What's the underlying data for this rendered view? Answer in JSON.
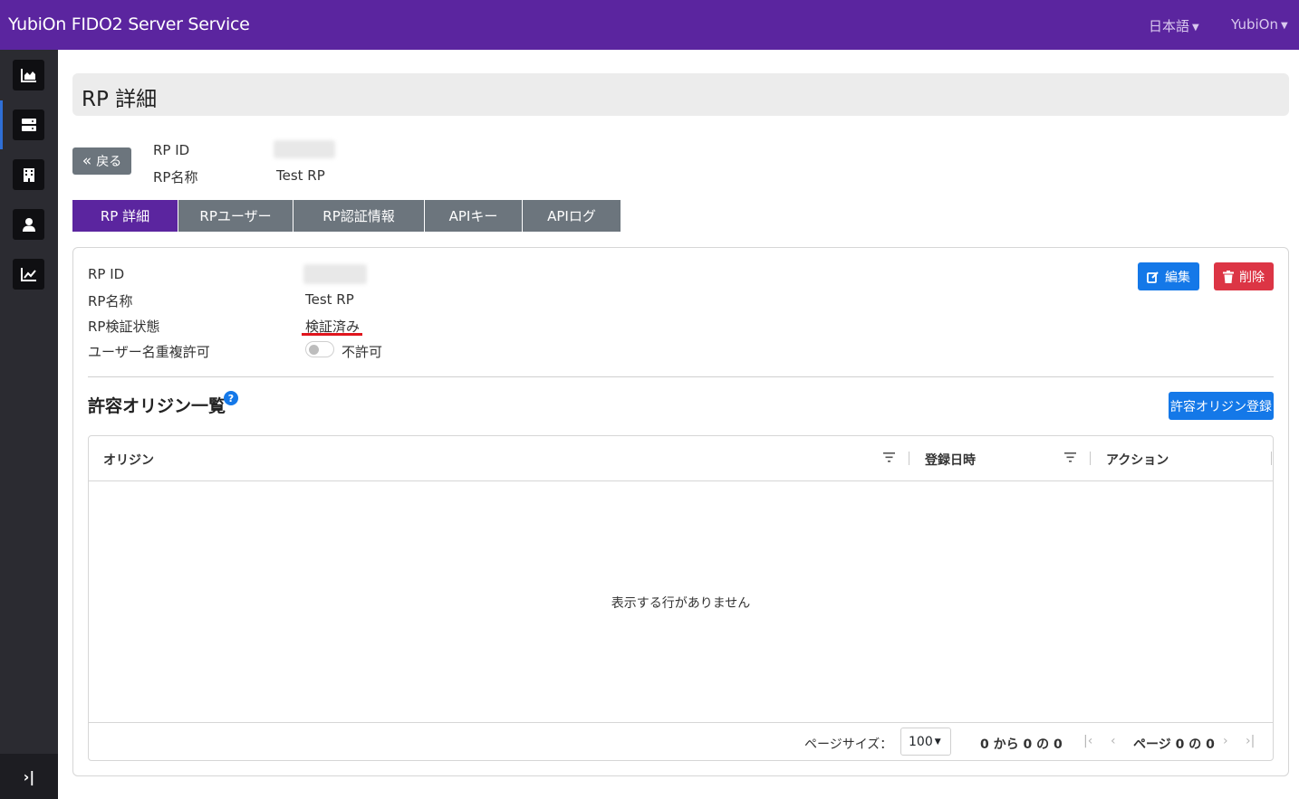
{
  "header": {
    "brand": "YubiOn FIDO2 Server Service",
    "language": "日本語",
    "user": "YubiOn"
  },
  "sidebar": {
    "items": [
      {
        "icon": "area-chart-icon",
        "active": false
      },
      {
        "icon": "server-icon",
        "active": true
      },
      {
        "icon": "building-icon",
        "active": false
      },
      {
        "icon": "user-icon",
        "active": false
      },
      {
        "icon": "line-chart-icon",
        "active": false
      }
    ],
    "collapse_icon": "›|"
  },
  "page": {
    "title": "RP 詳細"
  },
  "summary": {
    "back_label": "戻る",
    "rp_id_label": "RP ID",
    "rp_name_label": "RP名称",
    "rp_name_value": "Test RP"
  },
  "tabs": [
    {
      "label": "RP 詳細",
      "active": true
    },
    {
      "label": "RPユーザー",
      "active": false
    },
    {
      "label": "RP認証情報",
      "active": false
    },
    {
      "label": "APIキー",
      "active": false
    },
    {
      "label": "APIログ",
      "active": false
    }
  ],
  "details": {
    "rp_id_label": "RP ID",
    "rp_name_label": "RP名称",
    "rp_name_value": "Test RP",
    "verify_label": "RP検証状態",
    "verify_value": "検証済み",
    "dup_label": "ユーザー名重複許可",
    "dup_value": "不許可",
    "edit_label": "編集",
    "delete_label": "削除"
  },
  "origins": {
    "title": "許容オリジン一覧",
    "help": "?",
    "register_label": "許容オリジン登録",
    "columns": [
      "オリジン",
      "登録日時",
      "アクション"
    ],
    "empty_message": "表示する行がありません",
    "page_size_label": "ページサイズ：",
    "page_size_value": "100",
    "range_text": "0 から 0 の 0",
    "page_text": "ページ 0 の 0"
  },
  "colors": {
    "brand": "#5b259f",
    "primary": "#1478e8",
    "danger": "#dc3545",
    "secondary": "#6c757d"
  }
}
